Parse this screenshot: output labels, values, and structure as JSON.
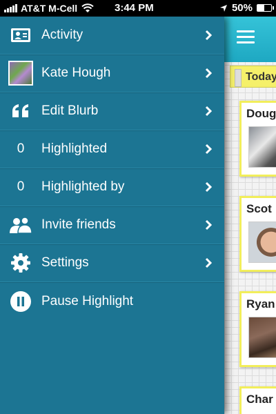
{
  "status_bar": {
    "carrier": "AT&T M-Cell",
    "time": "3:44 PM",
    "battery": "50%",
    "battery_level": 0.5
  },
  "menu": {
    "items": [
      {
        "label": "Activity",
        "icon": "id-card-icon",
        "has_chevron": true
      },
      {
        "label": "Kate Hough",
        "icon": "avatar",
        "has_chevron": true
      },
      {
        "label": "Edit Blurb",
        "icon": "quote-icon",
        "has_chevron": true
      },
      {
        "label": "Highlighted",
        "count": "0",
        "has_chevron": true
      },
      {
        "label": "Highlighted by",
        "count": "0",
        "has_chevron": true
      },
      {
        "label": "Invite friends",
        "icon": "people-icon",
        "has_chevron": true
      },
      {
        "label": "Settings",
        "icon": "gear-icon",
        "has_chevron": true
      },
      {
        "label": "Pause Highlight",
        "icon": "pause-icon",
        "has_chevron": false
      }
    ]
  },
  "feed": {
    "today_label": "Today",
    "cards": [
      {
        "name": "Doug"
      },
      {
        "name": "Scot"
      },
      {
        "name": "Ryan"
      },
      {
        "name": "Char"
      }
    ]
  },
  "colors": {
    "drawer_bg": "#1c7593",
    "header_bg": "#1ea8c2",
    "highlight_yellow": "#f2ee5a"
  }
}
